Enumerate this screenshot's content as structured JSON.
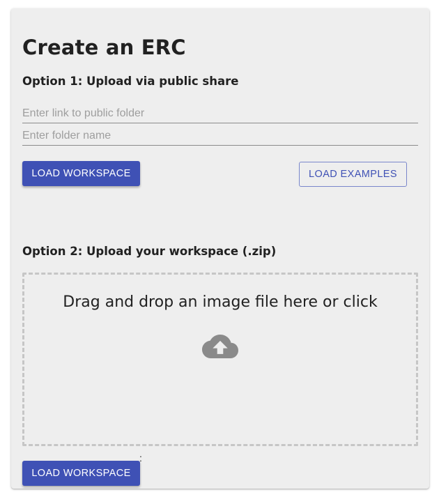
{
  "page": {
    "title": "Create an ERC"
  },
  "option1": {
    "heading": "Option 1: Upload via public share",
    "link_input": {
      "value": "",
      "placeholder": "Enter link to public folder"
    },
    "folder_input": {
      "value": "",
      "placeholder": "Enter folder name"
    },
    "load_workspace_label": "LOAD WORKSPACE",
    "load_examples_label": "LOAD EXAMPLES"
  },
  "option2": {
    "heading": "Option 2: Upload your workspace (.zip)",
    "dropzone": {
      "text": "Drag and drop an image file here or click",
      "icon": "cloud-upload-icon"
    },
    "separator": ":",
    "load_workspace_label": "LOAD WORKSPACE"
  },
  "colors": {
    "primary": "#3f51b5",
    "card_background": "#eeeeee",
    "icon": "#8a8a8a"
  }
}
